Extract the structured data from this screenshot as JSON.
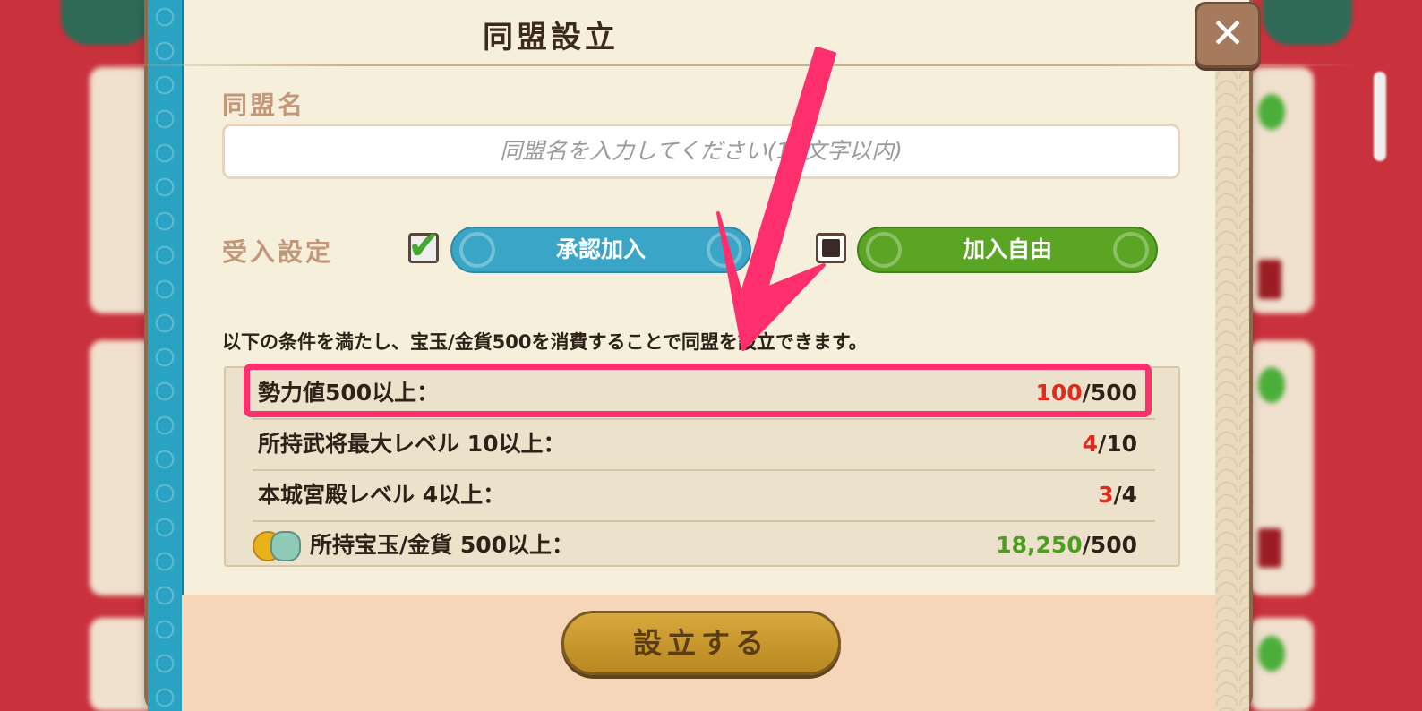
{
  "dialog": {
    "title": "同盟設立",
    "close_label": "✕"
  },
  "name": {
    "label": "同盟名",
    "placeholder": "同盟名を入力してください(12文字以内)"
  },
  "accept": {
    "label": "受入設定",
    "options": [
      {
        "label": "承認加入",
        "checked": true
      },
      {
        "label": "加入自由",
        "checked": false
      }
    ]
  },
  "description": "以下の条件を満たし、宝玉/金貨500を消費することで同盟を設立できます。",
  "conditions": [
    {
      "label": "勢力値500以上：",
      "current": "100",
      "required": "/500",
      "status": "insufficient"
    },
    {
      "label": "所持武将最大レベル 10以上：",
      "current": "4",
      "required": "/10",
      "status": "insufficient"
    },
    {
      "label": "本城宮殿レベル 4以上：",
      "current": "3",
      "required": "/4",
      "status": "insufficient"
    },
    {
      "label": "所持宝玉/金貨 500以上：",
      "current": "18,250",
      "required": "/500",
      "status": "sufficient"
    }
  ],
  "submit_label": "設立する",
  "colors": {
    "accent_pink": "#ff2f6e",
    "insufficient": "#e02a1e",
    "sufficient": "#4d9d22"
  }
}
